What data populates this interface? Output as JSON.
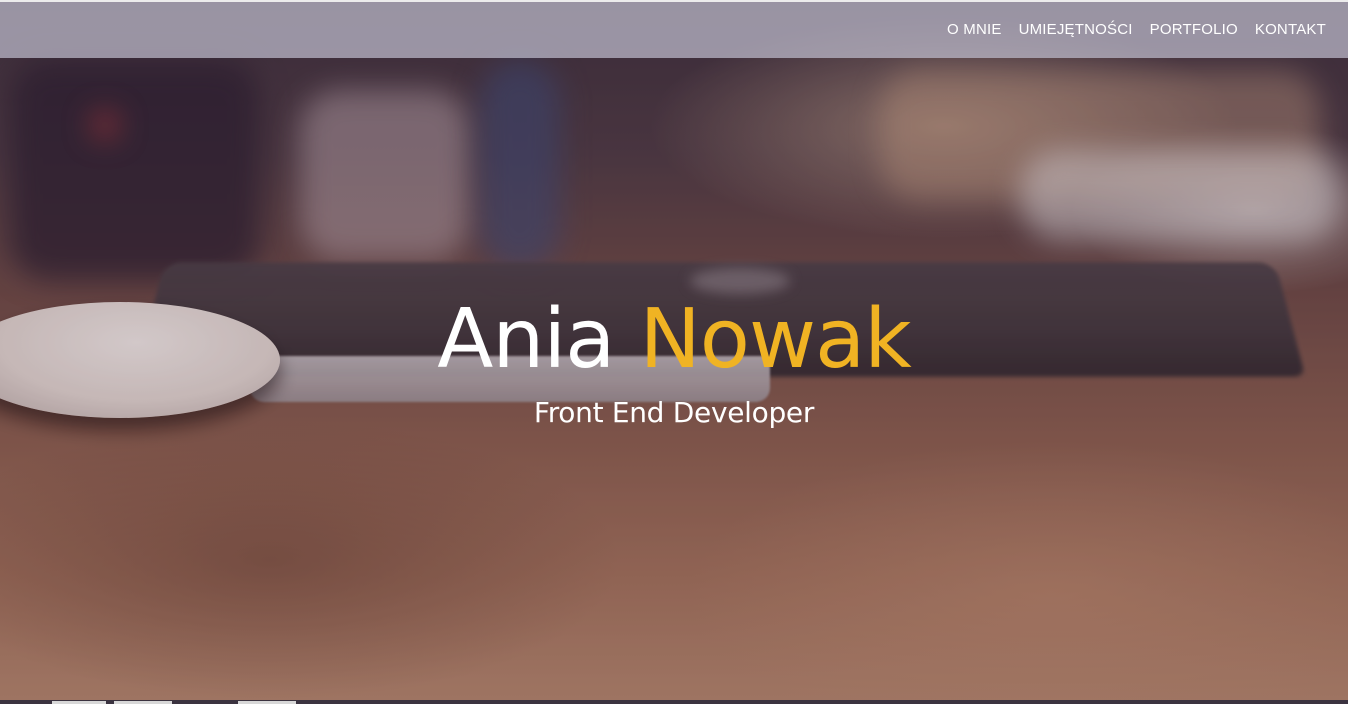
{
  "nav": {
    "items": [
      {
        "label": "O MNIE"
      },
      {
        "label": "UMIEJĘTNOŚCI"
      },
      {
        "label": "PORTFOLIO"
      },
      {
        "label": "KONTAKT"
      }
    ]
  },
  "hero": {
    "first_name": "Ania",
    "last_name": "Nowak",
    "subtitle": "Front End Developer"
  },
  "colors": {
    "accent": "#f0b323",
    "text": "#ffffff",
    "navbar_bg": "#bebccd"
  },
  "background_image": "blurred-laptop-mouse-on-desk"
}
